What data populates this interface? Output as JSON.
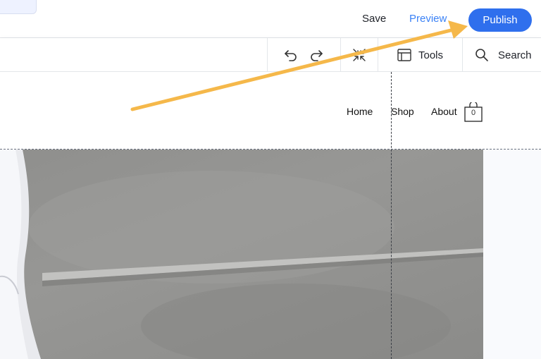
{
  "topbar": {
    "save_label": "Save",
    "preview_label": "Preview",
    "publish_label": "Publish"
  },
  "toolbar": {
    "undo_icon": "undo-icon",
    "redo_icon": "redo-icon",
    "collapse_icon": "collapse-arrows-icon",
    "tools_label": "Tools",
    "search_label": "Search"
  },
  "site": {
    "nav": [
      "Home",
      "Shop",
      "About"
    ],
    "cart_count": "0"
  },
  "colors": {
    "accent": "#2f6fed",
    "preview": "#3b82f6",
    "annotation_arrow": "#f5b84a"
  }
}
